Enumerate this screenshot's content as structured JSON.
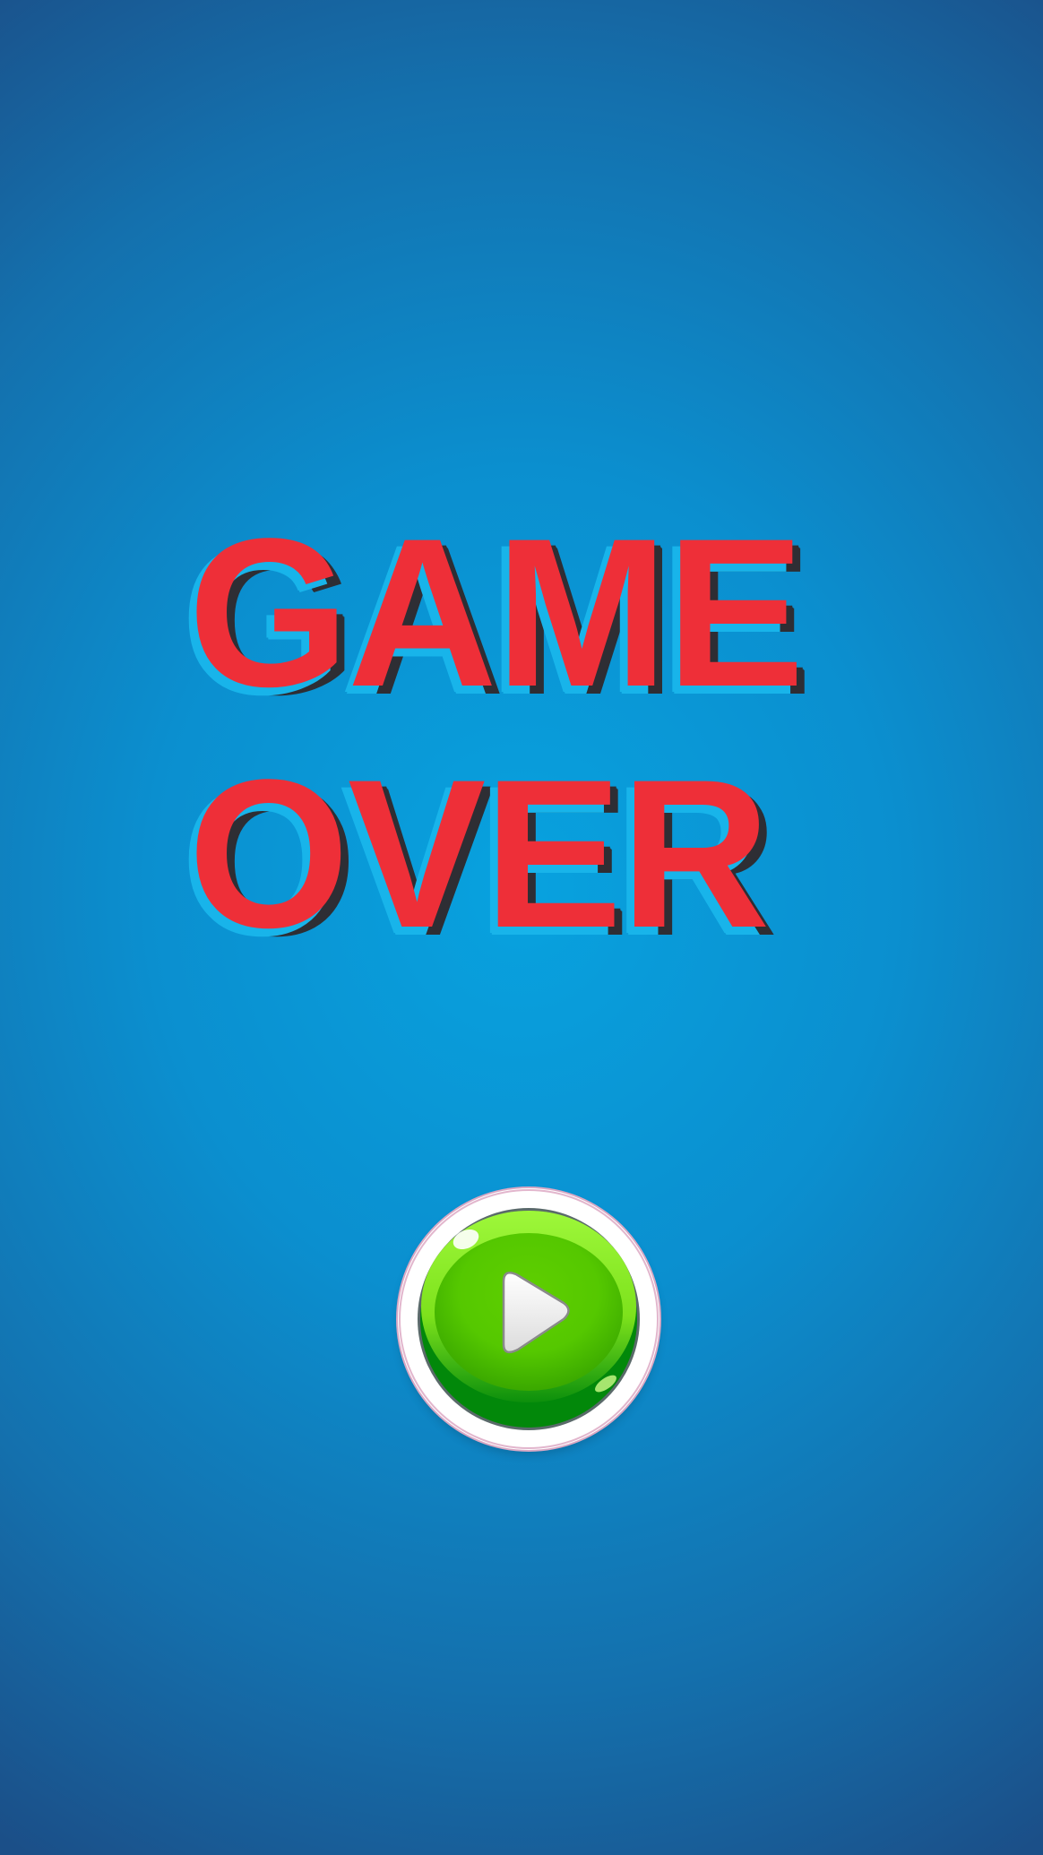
{
  "screen": {
    "title_line_1": "GAME",
    "title_line_2": "OVER"
  },
  "play_button": {
    "icon": "play-icon",
    "colors": {
      "ring": "#ffffff",
      "ball_light": "#8ff22b",
      "ball_mid": "#58c900",
      "ball_dark": "#028a0a",
      "glyph": "#f2f2f2"
    }
  },
  "colors": {
    "title_fill": "#ee2f38",
    "title_shadow_dark": "#2e2e34",
    "title_shadow_cyan": "#18b4ea",
    "background_center": "#08a2df",
    "background_edge": "#1b4f88"
  }
}
